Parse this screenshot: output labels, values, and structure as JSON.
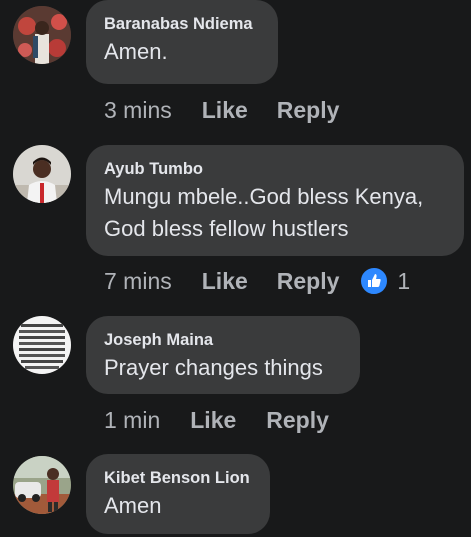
{
  "comments": [
    {
      "author": "Baranabas Ndiema",
      "text": "Amen.",
      "time": "3 mins",
      "like_label": "Like",
      "reply_label": "Reply"
    },
    {
      "author": "Ayub Tumbo",
      "text_line1": "Mungu mbele..God bless Kenya,",
      "text_line2": "God bless fellow hustlers",
      "time": "7 mins",
      "like_label": "Like",
      "reply_label": "Reply",
      "reaction_icon": "like-thumb-icon",
      "reaction_count": "1"
    },
    {
      "author": "Joseph Maina",
      "text": "Prayer changes things",
      "time": "1 min",
      "like_label": "Like",
      "reply_label": "Reply"
    },
    {
      "author": "Kibet Benson Lion",
      "text": "Amen"
    }
  ],
  "colors": {
    "background": "#18191a",
    "bubble": "#3a3b3c",
    "text": "#e4e6eb",
    "muted": "#b0b3b8",
    "like_blue": "#2d88ff"
  }
}
